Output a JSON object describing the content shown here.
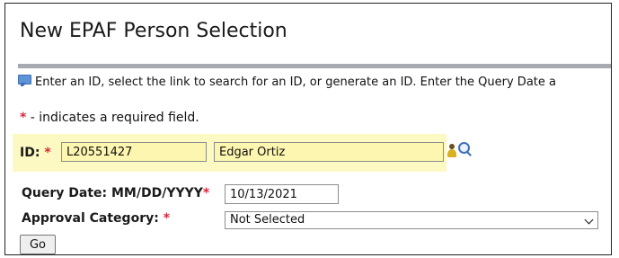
{
  "page": {
    "title": "New EPAF Person Selection"
  },
  "info": {
    "text": "Enter an ID, select the link to search for an ID, or generate an ID. Enter the Query Date a"
  },
  "required_note": {
    "marker": "*",
    "text": " - indicates a required field."
  },
  "form": {
    "id_label": "ID:",
    "required_marker": "*",
    "id_value": "L20551427",
    "name_value": "Edgar Ortiz",
    "query_date_label": "Query Date: MM/DD/YYYY",
    "query_date_value": "10/13/2021",
    "approval_category_label": "Approval Category:",
    "approval_category_selected": "Not Selected",
    "go_label": "Go"
  },
  "icons": {
    "info": "info-speech-icon",
    "person": "person-icon",
    "search": "magnifier-icon"
  },
  "colors": {
    "required": "#e0243b",
    "highlight_band": "#fdf9c2",
    "input_yellow": "#fdf6b0",
    "rule": "#a7aab0"
  }
}
